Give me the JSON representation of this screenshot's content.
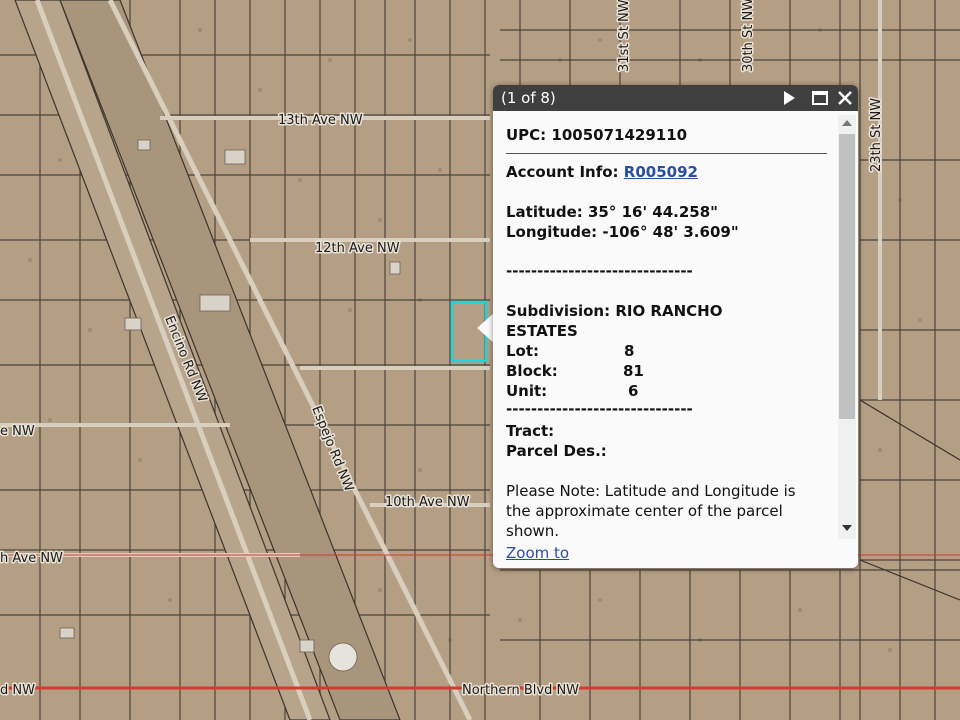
{
  "map": {
    "roads": {
      "thirteenth_ave": "13th Ave NW",
      "twelfth_ave": "12th Ave NW",
      "tenth_ave": "10th Ave NW",
      "encino": "Encino Rd NW",
      "espejo": "Espejo Rd NW",
      "thirtyfirst": "31st St NW",
      "thirtieth": "30th St NW",
      "twentythird": "23th St NW",
      "northern": "Northern Blvd NW",
      "left_partial_1": "e NW",
      "left_partial_2": "h Ave NW",
      "left_partial_3": "d NW"
    },
    "colors": {
      "terrain": "#b49e84",
      "parcel_line": "#3a3530",
      "highway": "#d63a2e",
      "selection": "#21d4d4"
    }
  },
  "popup": {
    "counter": "(1 of 8)",
    "upc_label": "UPC:",
    "upc_value": "1005071429110",
    "account_label": "Account Info:",
    "account_value": "R005092",
    "latitude_label": "Latitude:",
    "latitude_value": "35° 16' 44.258\"",
    "longitude_label": "Longitude:",
    "longitude_value": "-106° 48' 3.609\"",
    "separator": "------------------------------",
    "subdivision_label": "Subdivision:",
    "subdivision_value_1": "RIO RANCHO",
    "subdivision_value_2": "ESTATES",
    "lot_label": "Lot:",
    "lot_value": "8",
    "block_label": "Block:",
    "block_value": "81",
    "unit_label": "Unit:",
    "unit_value": "6",
    "tract_label": "Tract:",
    "parcel_des_label": "Parcel Des.:",
    "note_line_1": "Please Note: Latitude and Longitude is",
    "note_line_2": "the approximate center of the parcel",
    "note_line_3": "shown.",
    "zoom_link": "Zoom to"
  }
}
